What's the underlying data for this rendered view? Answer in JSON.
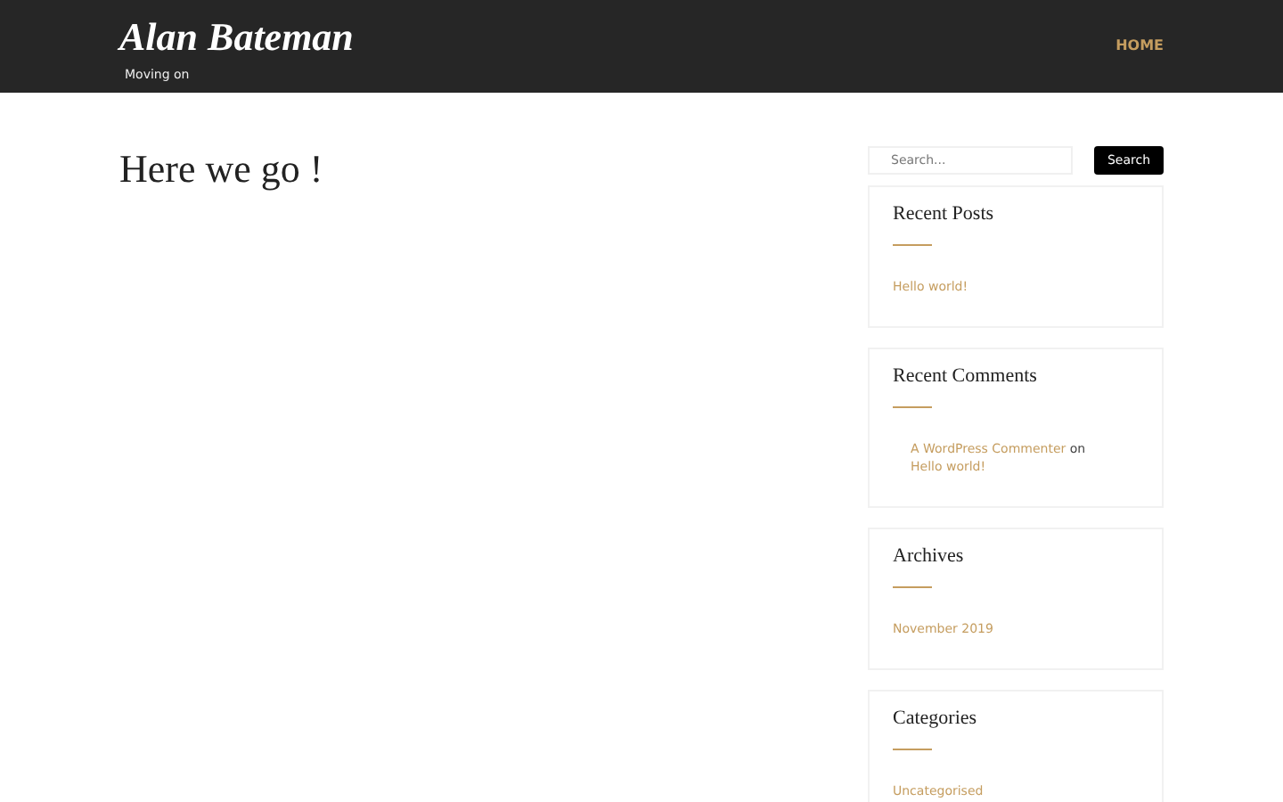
{
  "site": {
    "title": "Alan Bateman",
    "tagline": "Moving on"
  },
  "nav": [
    {
      "label": "HOME",
      "selected": true
    }
  ],
  "post": {
    "title": "Here we go !"
  },
  "search": {
    "placeholder": "Search...",
    "button": "Search"
  },
  "widgets": [
    {
      "title": "Recent Posts",
      "kind": "links",
      "items": [
        "Hello world!"
      ]
    },
    {
      "title": "Recent Comments",
      "kind": "comments",
      "items": [
        {
          "author": "A WordPress Commenter",
          "joiner": "on",
          "post": "Hello world!"
        }
      ]
    },
    {
      "title": "Archives",
      "kind": "links",
      "items": [
        "November 2019"
      ]
    },
    {
      "title": "Categories",
      "kind": "links",
      "items": [
        "Uncategorised"
      ]
    }
  ]
}
